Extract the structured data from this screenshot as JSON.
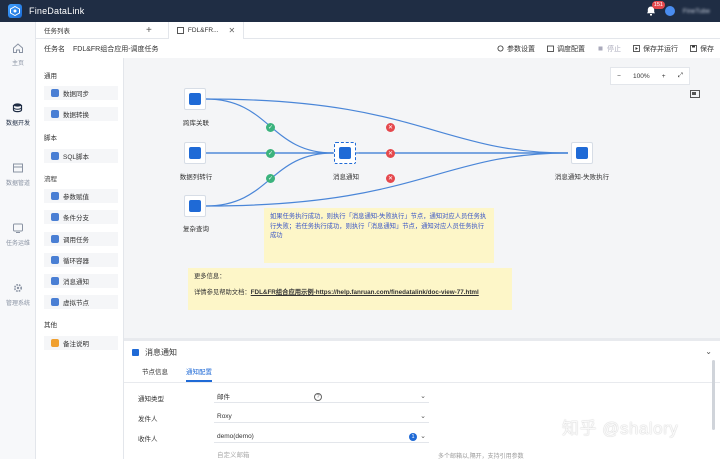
{
  "app": {
    "title": "FineDataLink",
    "notification_count": "151",
    "user_name": "FineTube"
  },
  "leftnav": [
    {
      "label": "主页"
    },
    {
      "label": "数据开发"
    },
    {
      "label": "数据管道"
    },
    {
      "label": "任务运维"
    },
    {
      "label": "管理系统"
    }
  ],
  "tabs": {
    "list_label": "任务列表",
    "active_label": "FDL&FR..."
  },
  "task": {
    "name_label": "任务名",
    "name_value": "FDL&FR组合应用-调度任务",
    "actions": {
      "params": "参数设置",
      "schedule": "调度配置",
      "stop": "停止",
      "save_run": "保存并运行",
      "save": "保存"
    }
  },
  "palette": {
    "groups": {
      "general": "通用",
      "script": "脚本",
      "flow": "流程",
      "other": "其他"
    },
    "items": {
      "sync": "数据同步",
      "transform": "数据转换",
      "sql": "SQL脚本",
      "param": "参数赋值",
      "branch": "条件分支",
      "call": "调用任务",
      "loop": "循环容器",
      "message": "消息通知",
      "virtual": "虚拟节点",
      "remark": "备注说明"
    }
  },
  "canvas": {
    "zoom": "100%",
    "nodes": {
      "cross_db": "跨库关联",
      "to_row": "数据列转行",
      "complex": "复杂查询",
      "notify": "消息通知",
      "notify_fail": "消息通知-失败执行"
    },
    "note1": "如果任务执行成功，则执行「消息通知-失败执行」节点，通知对应人员任务执行失败；若任务执行成功，则执行「消息通知」节点，通知对应人员任务执行成功",
    "note2_title": "更多信息：",
    "note2_prefix": "详情参见帮助文档：",
    "note2_link": "FDL&FR组合应用示例-https://help.fanruan.com/finedatalink/doc-view-77.html"
  },
  "props": {
    "title": "消息通知",
    "tabs": {
      "node_info": "节点信息",
      "notify_config": "通知配置"
    },
    "fields": {
      "type_label": "通知类型",
      "type_value": "邮件",
      "sender_label": "发件人",
      "sender_value": "Roxy",
      "receiver_label": "收件人",
      "receiver_value": "demo(demo)",
      "receiver_count": "1",
      "custom_placeholder": "自定义邮箱",
      "hint": "多个邮箱以,隔开，支持引用参数"
    }
  },
  "watermark": "知乎 @shalory",
  "colors": {
    "topbar": "#1f2d44",
    "accent": "#1f6ad6",
    "success": "#3bb37d",
    "fail": "#e5484d",
    "note": "#fdf6c8"
  }
}
